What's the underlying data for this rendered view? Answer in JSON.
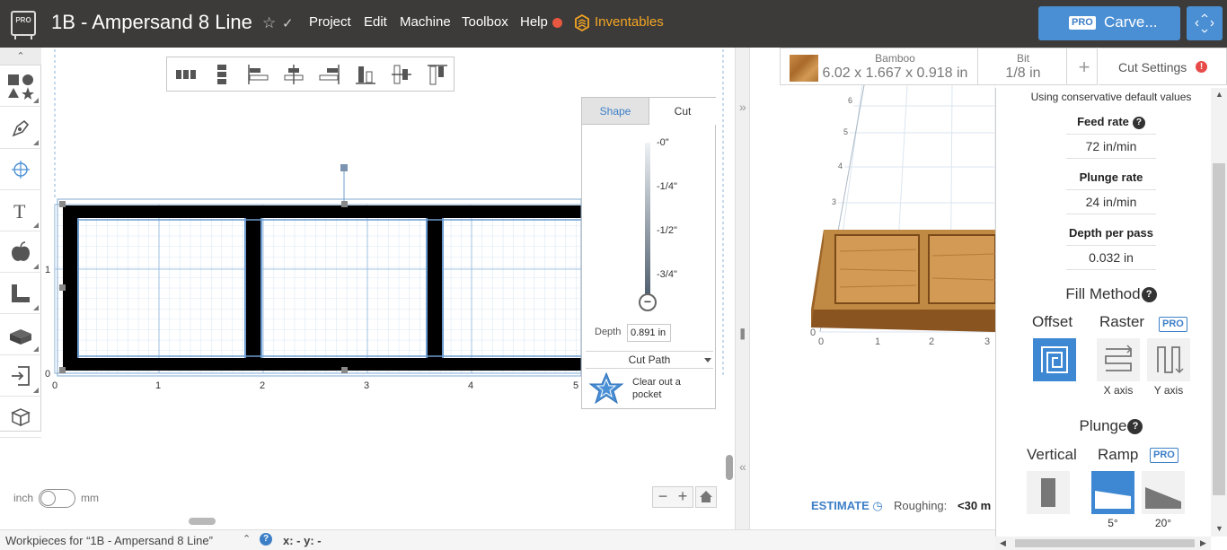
{
  "header": {
    "logo_text": "PRO",
    "project_title": "1B - Ampersand 8 Line",
    "menu": [
      "Project",
      "Edit",
      "Machine",
      "Toolbox",
      "Help"
    ],
    "inventables_label": "Inventables",
    "carve_badge": "PRO",
    "carve_label": "Carve..."
  },
  "canvas": {
    "x_ticks": [
      "0",
      "1",
      "2",
      "3",
      "4",
      "5"
    ],
    "y_ticks": [
      "0",
      "1"
    ],
    "unit_inch": "inch",
    "unit_mm": "mm",
    "unit_selected": "inch",
    "zoom_out": "−",
    "zoom_in": "+"
  },
  "cut_panel": {
    "tabs": [
      "Shape",
      "Cut"
    ],
    "active_tab": "Cut",
    "depth_ticks": [
      "-0\"",
      "-1/4\"",
      "-1/2\"",
      "-3/4\""
    ],
    "depth_label": "Depth",
    "depth_value": "0.891 in",
    "cut_path_label": "Cut Path",
    "cut_type_label": "Clear out a pocket"
  },
  "material": {
    "name": "Bamboo",
    "dimensions": "6.02 x 1.667 x 0.918 in",
    "bit_label": "Bit",
    "bit_value": "1/8 in",
    "add_label": "+"
  },
  "cut_settings": {
    "tab_label": "Cut Settings",
    "note": "Using conservative default values",
    "feed_rate_label": "Feed rate",
    "feed_rate_value": "72 in/min",
    "plunge_rate_label": "Plunge rate",
    "plunge_rate_value": "24 in/min",
    "depth_per_pass_label": "Depth per pass",
    "depth_per_pass_value": "0.032 in",
    "fill_method_heading": "Fill Method",
    "offset_label": "Offset",
    "raster_label": "Raster",
    "pro_badge": "PRO",
    "x_axis_label": "X axis",
    "y_axis_label": "Y axis",
    "plunge_heading": "Plunge",
    "vertical_label": "Vertical",
    "ramp_label": "Ramp",
    "ramp_5_label": "5°",
    "ramp_20_label": "20°",
    "selected_fill": "Offset",
    "selected_plunge": "5°"
  },
  "preview": {
    "grid_x_ticks": [
      "0",
      "1",
      "2",
      "3"
    ],
    "grid_y_ticks": [
      "3",
      "4",
      "5",
      "6"
    ],
    "estimate_label": "ESTIMATE",
    "roughing_label": "Roughing:",
    "roughing_value": "<30 m"
  },
  "footer": {
    "workpieces_label": "Workpieces for “1B - Ampersand 8 Line”",
    "help": "?",
    "coords": "x: - y: -"
  },
  "colors": {
    "topbar": "#3c3b3a",
    "accent": "#3d87d3",
    "inventables": "#f5a623",
    "canvas_bg": "#cde3f7",
    "warning": "#e84a4a"
  }
}
